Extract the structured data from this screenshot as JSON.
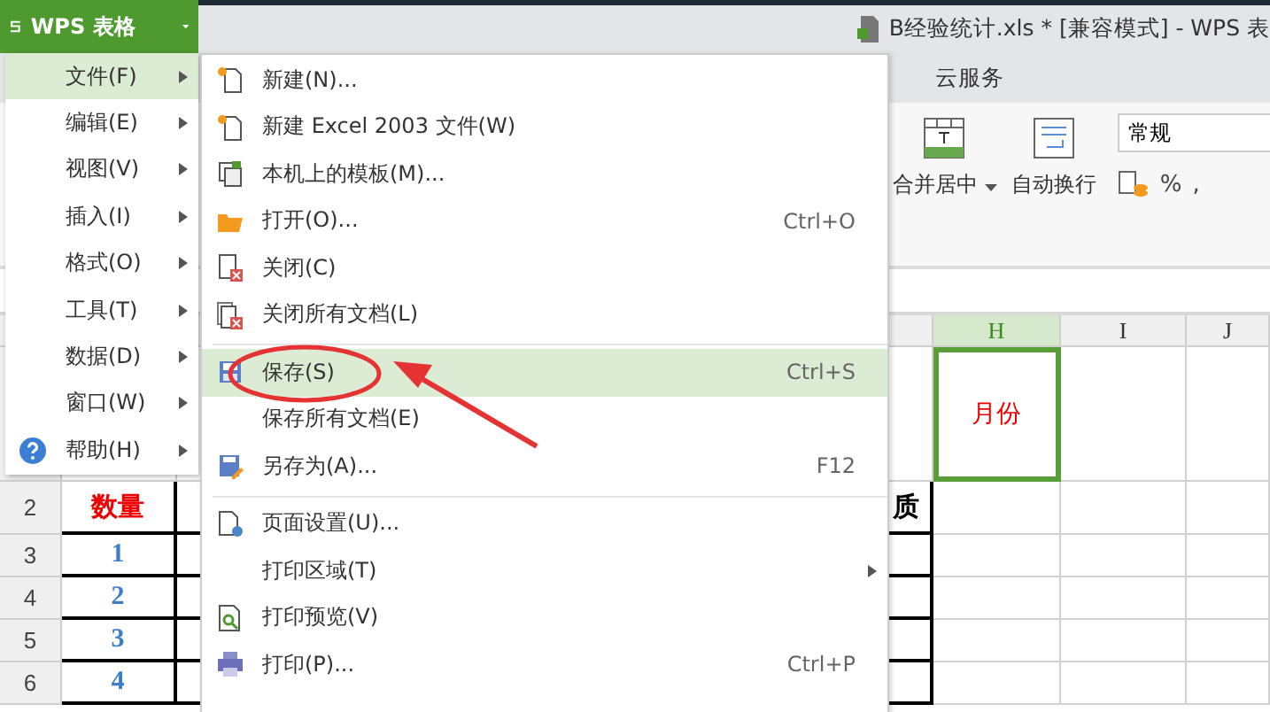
{
  "app_button": {
    "label": "WPS 表格"
  },
  "title": "B经验统计.xls * [兼容模式] - WPS 表",
  "ribbon": {
    "tabs": [
      {
        "label": "云服务"
      }
    ],
    "merge_label": "合并居中",
    "wrap_label": "自动换行",
    "number_format": "常规",
    "percent": "%",
    "comma": ","
  },
  "sheet": {
    "columns": [
      {
        "label": "H",
        "selected": true
      },
      {
        "label": "I",
        "selected": false
      },
      {
        "label": "J",
        "selected": false
      }
    ],
    "rows": [
      {
        "b": "",
        "kind": "plain",
        "h": "月份",
        "h_selected": true
      },
      {
        "number": "2",
        "b": "数量",
        "kind": "header",
        "hidden": "质",
        "h_selected": false
      },
      {
        "number": "3",
        "b": "1",
        "kind": "value",
        "h_selected": false
      },
      {
        "number": "4",
        "b": "2",
        "kind": "value",
        "h_selected": false
      },
      {
        "number": "5",
        "b": "3",
        "kind": "value",
        "h_selected": false
      },
      {
        "number": "6",
        "b": "4",
        "kind": "value",
        "h_selected": false
      }
    ]
  },
  "main_menu": [
    {
      "label": "文件(F)",
      "selected": true,
      "kind": "plain"
    },
    {
      "label": "编辑(E)",
      "selected": false,
      "kind": "plain"
    },
    {
      "label": "视图(V)",
      "selected": false,
      "kind": "plain"
    },
    {
      "label": "插入(I)",
      "selected": false,
      "kind": "plain"
    },
    {
      "label": "格式(O)",
      "selected": false,
      "kind": "plain"
    },
    {
      "label": "工具(T)",
      "selected": false,
      "kind": "plain"
    },
    {
      "label": "数据(D)",
      "selected": false,
      "kind": "plain"
    },
    {
      "label": "窗口(W)",
      "selected": false,
      "kind": "plain"
    },
    {
      "label": "帮助(H)",
      "selected": false,
      "kind": "help"
    }
  ],
  "file_menu": [
    {
      "kind": "item",
      "label": "新建(N)...",
      "selected": false
    },
    {
      "kind": "item",
      "label": "新建 Excel 2003 文件(W)",
      "selected": false
    },
    {
      "kind": "item",
      "label": "本机上的模板(M)...",
      "selected": false
    },
    {
      "kind": "item",
      "label": "打开(O)...",
      "shortcut": "Ctrl+O",
      "selected": false
    },
    {
      "kind": "item",
      "label": "关闭(C)",
      "selected": false
    },
    {
      "kind": "item",
      "label": "关闭所有文档(L)",
      "selected": false
    },
    {
      "kind": "separator"
    },
    {
      "kind": "item",
      "label": "保存(S)",
      "shortcut": "Ctrl+S",
      "selected": true
    },
    {
      "kind": "item",
      "label": "保存所有文档(E)",
      "selected": false
    },
    {
      "kind": "item",
      "label": "另存为(A)...",
      "shortcut": "F12",
      "selected": false
    },
    {
      "kind": "separator"
    },
    {
      "kind": "item",
      "label": "页面设置(U)...",
      "selected": false
    },
    {
      "kind": "submenu",
      "label": "打印区域(T)",
      "selected": false
    },
    {
      "kind": "item",
      "label": "打印预览(V)",
      "selected": false
    },
    {
      "kind": "item",
      "label": "打印(P)...",
      "shortcut": "Ctrl+P",
      "selected": false
    }
  ]
}
